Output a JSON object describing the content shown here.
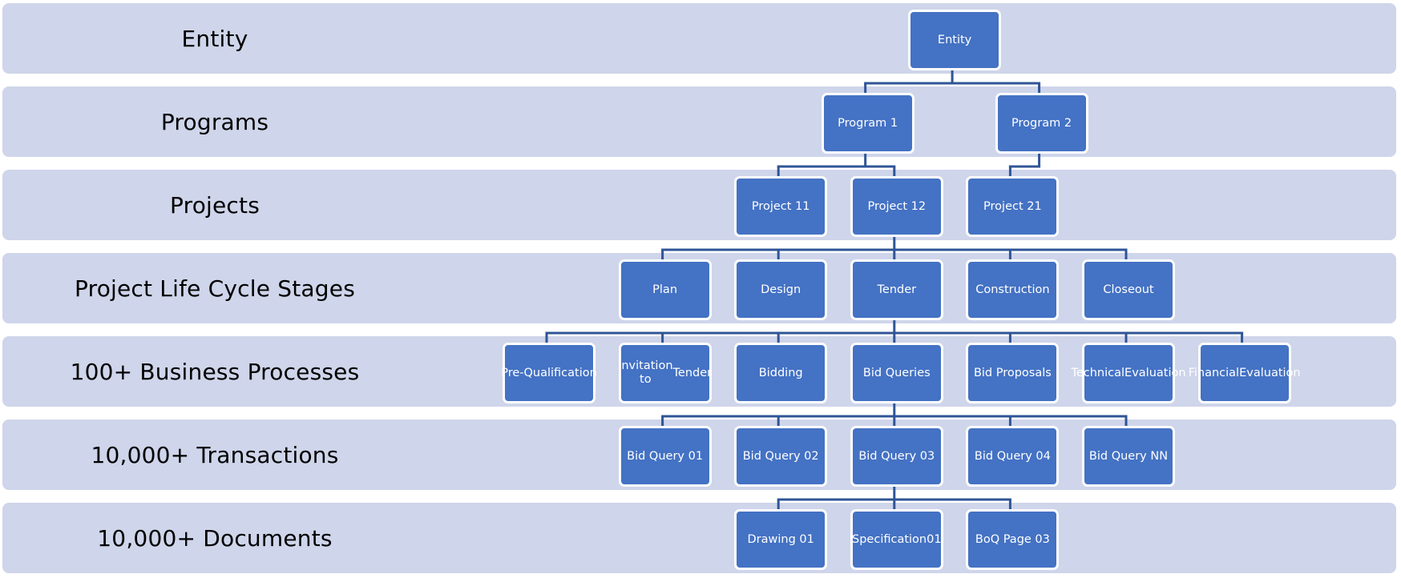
{
  "colors": {
    "band": "#CFD5EA",
    "node_fill": "#4472C4",
    "node_border": "#FFFFFF",
    "node_text": "#FFFFFF",
    "connector": "#2F5597",
    "label_text": "#000000"
  },
  "levels": [
    {
      "id": "entity",
      "label": "Entity"
    },
    {
      "id": "programs",
      "label": "Programs"
    },
    {
      "id": "projects",
      "label": "Projects"
    },
    {
      "id": "stages",
      "label": "Project Life Cycle Stages"
    },
    {
      "id": "processes",
      "label": "100+ Business Processes"
    },
    {
      "id": "transactions",
      "label": "10,000+ Transactions"
    },
    {
      "id": "documents",
      "label": "10,000+ Documents"
    }
  ],
  "nodes": [
    {
      "id": "entity",
      "level": 0,
      "slot": 3.5,
      "text": "Entity",
      "parent": null
    },
    {
      "id": "program-1",
      "level": 1,
      "slot": 2.75,
      "text": "Program 1",
      "parent": "entity"
    },
    {
      "id": "program-2",
      "level": 1,
      "slot": 4.25,
      "text": "Program 2",
      "parent": "entity"
    },
    {
      "id": "project-11",
      "level": 2,
      "slot": 2,
      "text": "Project 11",
      "parent": "program-1"
    },
    {
      "id": "project-12",
      "level": 2,
      "slot": 3,
      "text": "Project 12",
      "parent": "program-1"
    },
    {
      "id": "project-21",
      "level": 2,
      "slot": 4,
      "text": "Project 21",
      "parent": "program-2"
    },
    {
      "id": "plan",
      "level": 3,
      "slot": 1,
      "text": "Plan",
      "parent": "project-12"
    },
    {
      "id": "design",
      "level": 3,
      "slot": 2,
      "text": "Design",
      "parent": "project-12"
    },
    {
      "id": "tender",
      "level": 3,
      "slot": 3,
      "text": "Tender",
      "parent": "project-12"
    },
    {
      "id": "construction",
      "level": 3,
      "slot": 4,
      "text": "Construction",
      "parent": "project-12"
    },
    {
      "id": "closeout",
      "level": 3,
      "slot": 5,
      "text": "Closeout",
      "parent": "project-12"
    },
    {
      "id": "pre-qualification",
      "level": 4,
      "slot": 0,
      "text": "Pre-\nQualification",
      "parent": "tender"
    },
    {
      "id": "invitation-to-tender",
      "level": 4,
      "slot": 1,
      "text": "Invitation to\nTender",
      "parent": "tender"
    },
    {
      "id": "bidding",
      "level": 4,
      "slot": 2,
      "text": "Bidding",
      "parent": "tender"
    },
    {
      "id": "bid-queries",
      "level": 4,
      "slot": 3,
      "text": "Bid Queries",
      "parent": "tender"
    },
    {
      "id": "bid-proposals",
      "level": 4,
      "slot": 4,
      "text": "Bid Proposals",
      "parent": "tender"
    },
    {
      "id": "technical-evaluation",
      "level": 4,
      "slot": 5,
      "text": "Technical\nEvaluation",
      "parent": "tender"
    },
    {
      "id": "financial-evaluation",
      "level": 4,
      "slot": 6,
      "text": "Financial\nEvaluation",
      "parent": "tender"
    },
    {
      "id": "bid-query-01",
      "level": 5,
      "slot": 1,
      "text": "Bid Query 01",
      "parent": "bid-queries"
    },
    {
      "id": "bid-query-02",
      "level": 5,
      "slot": 2,
      "text": "Bid Query 02",
      "parent": "bid-queries"
    },
    {
      "id": "bid-query-03",
      "level": 5,
      "slot": 3,
      "text": "Bid Query 03",
      "parent": "bid-queries"
    },
    {
      "id": "bid-query-04",
      "level": 5,
      "slot": 4,
      "text": "Bid Query 04",
      "parent": "bid-queries"
    },
    {
      "id": "bid-query-nn",
      "level": 5,
      "slot": 5,
      "text": "Bid Query NN",
      "parent": "bid-queries"
    },
    {
      "id": "drawing-01",
      "level": 6,
      "slot": 2,
      "text": "Drawing 01",
      "parent": "bid-query-03"
    },
    {
      "id": "specification-01",
      "level": 6,
      "slot": 3,
      "text": "Specification\n01",
      "parent": "bid-query-03"
    },
    {
      "id": "boq-page-03",
      "level": 6,
      "slot": 4,
      "text": "BoQ Page 03",
      "parent": "bid-query-03"
    }
  ]
}
